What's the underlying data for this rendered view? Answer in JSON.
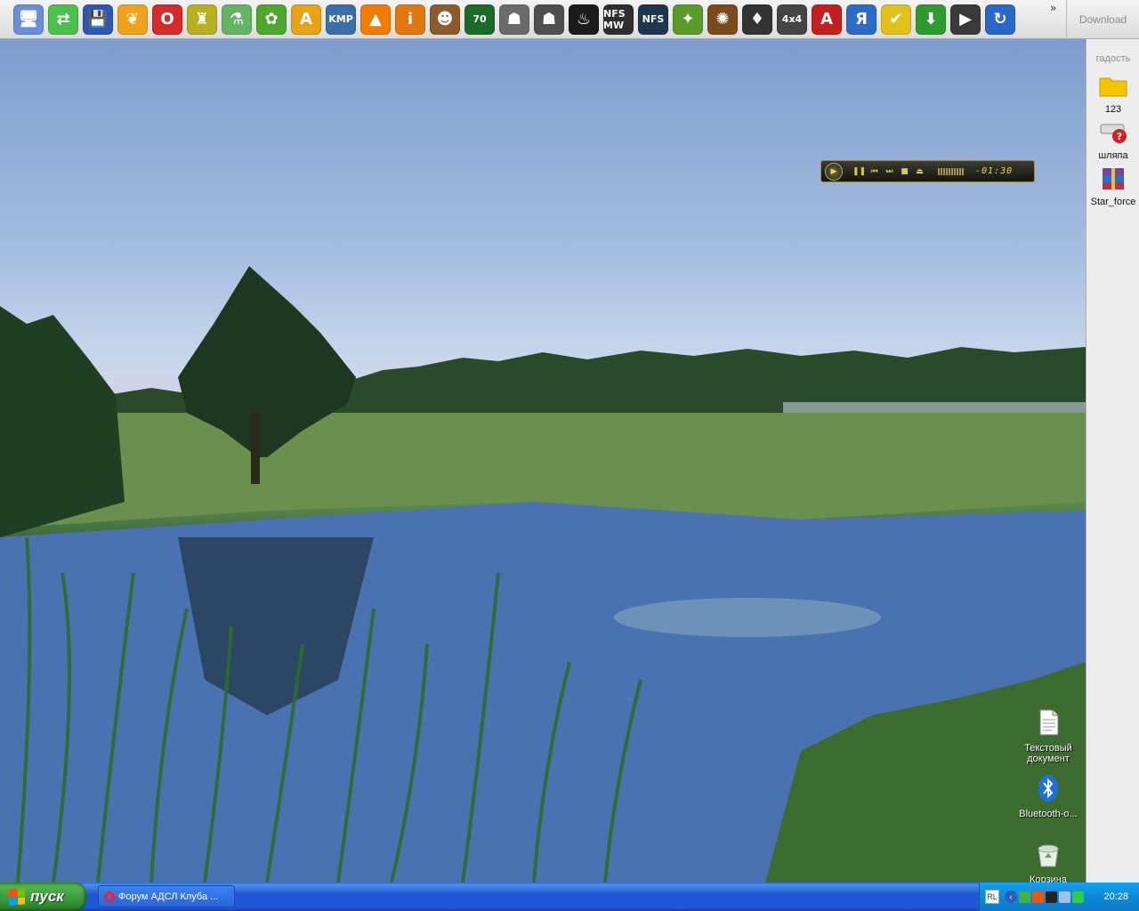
{
  "launcher": {
    "icons": [
      {
        "name": "my-computer-icon",
        "glyph": "🖥",
        "color": "#6a8fd6"
      },
      {
        "name": "network-icon",
        "glyph": "⇄",
        "color": "#4cbf4c"
      },
      {
        "name": "floppy-save-icon",
        "glyph": "💾",
        "color": "#2c56b8"
      },
      {
        "name": "butterfly-icon",
        "glyph": "❦",
        "color": "#f0a21c"
      },
      {
        "name": "opera-icon",
        "glyph": "O",
        "color": "#d52b2b"
      },
      {
        "name": "robot-icon",
        "glyph": "♜",
        "color": "#b7b021"
      },
      {
        "name": "chemistry-icon",
        "glyph": "⚗",
        "color": "#63b463"
      },
      {
        "name": "icq-flower-icon",
        "glyph": "✿",
        "color": "#4ea82f"
      },
      {
        "name": "aimp-icon",
        "glyph": "A",
        "color": "#e8a317"
      },
      {
        "name": "kmplayer-icon",
        "glyph": "KMP",
        "color": "#3a6ea8",
        "small": true
      },
      {
        "name": "vlc-cone-icon",
        "glyph": "▲",
        "color": "#f07d00"
      },
      {
        "name": "info-icon",
        "glyph": "i",
        "color": "#e0780f"
      },
      {
        "name": "game-character-icon",
        "glyph": "☻",
        "color": "#8a5b2b"
      },
      {
        "name": "game-green-icon",
        "glyph": "70",
        "color": "#1a6b2a",
        "small": true
      },
      {
        "name": "counter-strike-icon",
        "glyph": "☗",
        "color": "#6b6b6b"
      },
      {
        "name": "counter-strike-source-icon",
        "glyph": "☗",
        "color": "#4f4f4f"
      },
      {
        "name": "steam-icon",
        "glyph": "♨",
        "color": "#1b1b1b"
      },
      {
        "name": "nfs-most-wanted-icon",
        "glyph": "NFS MW",
        "color": "#2e2e2e",
        "small": true
      },
      {
        "name": "nfs-icon",
        "glyph": "NFS",
        "color": "#1f3550",
        "small": true
      },
      {
        "name": "crystal-icon",
        "glyph": "✦",
        "color": "#5a9b2a"
      },
      {
        "name": "game-art-icon",
        "glyph": "✺",
        "color": "#7a4a1a"
      },
      {
        "name": "bat-logo-icon",
        "glyph": "♦",
        "color": "#333333"
      },
      {
        "name": "4x4-icon",
        "glyph": "4x4",
        "color": "#444444",
        "small": true
      },
      {
        "name": "acrobat-icon",
        "glyph": "A",
        "color": "#c41e1e"
      },
      {
        "name": "yandex-icon",
        "glyph": "Я",
        "color": "#2b6cc4"
      },
      {
        "name": "yandex-disk-icon",
        "glyph": "✔",
        "color": "#e0c21a"
      },
      {
        "name": "download-master-icon",
        "glyph": "⬇",
        "color": "#2e9b2e"
      },
      {
        "name": "media-play-icon",
        "glyph": "▶",
        "color": "#3a3a3a"
      },
      {
        "name": "update-refresh-icon",
        "glyph": "↻",
        "color": "#2a68c8"
      }
    ],
    "chevron": "»",
    "download_label": "Download"
  },
  "side_panel": {
    "title": "гадость",
    "items": [
      {
        "label": "123",
        "icon": "folder-icon",
        "color": "#f5c400"
      },
      {
        "label": "шляпа",
        "icon": "drive-error-icon",
        "color": "#d9d9d9"
      },
      {
        "label": "Star_force",
        "icon": "winrar-archive-icon",
        "color": "#7d3fa6"
      }
    ]
  },
  "player": {
    "time": "-01:30",
    "buttons": [
      "▶",
      "❚❚",
      "⏮",
      "⏭",
      "■",
      "⏏"
    ]
  },
  "desktop_icons": [
    {
      "label": "Текстовый документ",
      "icon": "text-document-icon"
    },
    {
      "label": "Bluetooth-o...",
      "icon": "bluetooth-icon"
    },
    {
      "label": "Корзина",
      "icon": "recycle-bin-icon"
    }
  ],
  "taskbar": {
    "start_label": "пуск",
    "task_label": "Форум АДСЛ Клуба ...",
    "lang": "RL",
    "clock": "20:28"
  }
}
